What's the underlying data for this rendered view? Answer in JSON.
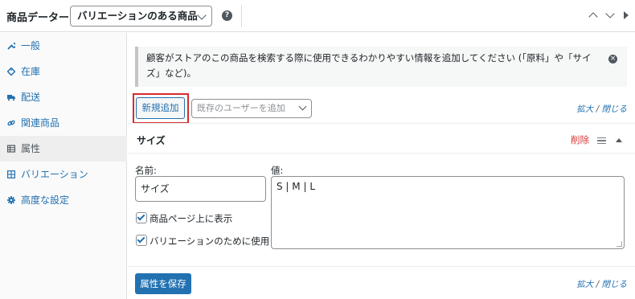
{
  "header": {
    "title": "商品データー",
    "product_type": "バリエーションのある商品",
    "help": "?"
  },
  "sidebar": {
    "items": [
      {
        "label": "一般",
        "icon": "wrench-icon"
      },
      {
        "label": "在庫",
        "icon": "tag-icon"
      },
      {
        "label": "配送",
        "icon": "truck-icon"
      },
      {
        "label": "関連商品",
        "icon": "link-icon"
      },
      {
        "label": "属性",
        "icon": "list-table-icon",
        "active": true
      },
      {
        "label": "バリエーション",
        "icon": "grid-icon"
      },
      {
        "label": "高度な設定",
        "icon": "gear-icon"
      }
    ]
  },
  "notice": {
    "text": "顧客がストアのこの商品を検索する際に使用できるわかりやすい情報を追加してください (「原料」や「サイズ」など)。",
    "close": "×"
  },
  "toolbar": {
    "add_new": "新規追加",
    "existing_placeholder": "既存のユーザーを追加",
    "expand": "拡大",
    "sep": "/",
    "close": "閉じる"
  },
  "attribute": {
    "name": "サイズ",
    "remove": "削除",
    "name_label": "名前:",
    "name_value": "サイズ",
    "value_label": "値:",
    "value_text": "S | M | L",
    "visible_label": "商品ページ上に表示",
    "variation_label": "バリエーションのために使用",
    "visible_checked": true,
    "variation_checked": true
  },
  "footer": {
    "save": "属性を保存",
    "expand": "拡大",
    "sep": "/",
    "close": "閉じる"
  },
  "colors": {
    "accent": "#2271b1",
    "danger": "#d63638",
    "highlight": "#d62c2c"
  }
}
